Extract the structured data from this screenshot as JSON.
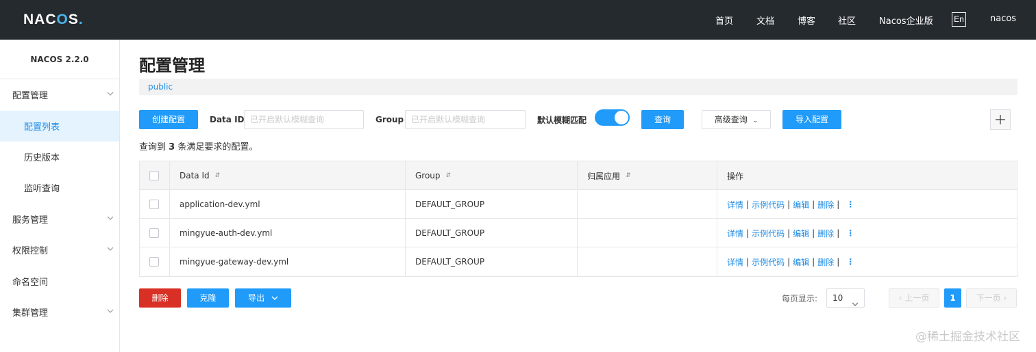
{
  "header": {
    "logo": "NACOS.",
    "nav": [
      "首页",
      "文档",
      "博客",
      "社区",
      "Nacos企业版"
    ],
    "lang": "En",
    "user": "nacos"
  },
  "sidebar": {
    "version": "NACOS 2.2.0",
    "items": [
      {
        "label": "配置管理",
        "type": "parent",
        "expandable": true
      },
      {
        "label": "配置列表",
        "type": "child",
        "active": true
      },
      {
        "label": "历史版本",
        "type": "child"
      },
      {
        "label": "监听查询",
        "type": "child"
      },
      {
        "label": "服务管理",
        "type": "parent",
        "expandable": true
      },
      {
        "label": "权限控制",
        "type": "parent",
        "expandable": true
      },
      {
        "label": "命名空间",
        "type": "parent",
        "expandable": false
      },
      {
        "label": "集群管理",
        "type": "parent",
        "expandable": true
      }
    ]
  },
  "main": {
    "title": "配置管理",
    "namespace": "public",
    "create_button": "创建配置",
    "dataid_label": "Data ID",
    "dataid_placeholder": "已开启默认模糊查询",
    "group_label": "Group",
    "group_placeholder": "已开启默认模糊查询",
    "fuzzy_label": "默认模糊匹配",
    "fuzzy_enabled": true,
    "search_button": "查询",
    "advanced_button": "高级查询",
    "import_button": "导入配置",
    "summary_prefix": "查询到",
    "summary_count": "3",
    "summary_suffix": "条满足要求的配置。"
  },
  "table": {
    "headers": [
      "Data Id",
      "Group",
      "归属应用",
      "操作"
    ],
    "rows": [
      {
        "data_id": "application-dev.yml",
        "group": "DEFAULT_GROUP",
        "app": ""
      },
      {
        "data_id": "mingyue-auth-dev.yml",
        "group": "DEFAULT_GROUP",
        "app": ""
      },
      {
        "data_id": "mingyue-gateway-dev.yml",
        "group": "DEFAULT_GROUP",
        "app": ""
      }
    ],
    "ops": [
      "详情",
      "示例代码",
      "编辑",
      "删除"
    ]
  },
  "footer": {
    "delete_button": "删除",
    "clone_button": "克隆",
    "export_button": "导出",
    "page_size_label": "每页显示:",
    "page_size": "10",
    "prev": "上一页",
    "current_page": "1",
    "next": "下一页"
  },
  "watermark": "@稀土掘金技术社区",
  "colors": {
    "topbar": "#252a2f",
    "primary": "#209bfa",
    "danger": "#d93026",
    "link": "#1e8ce6",
    "active_bg": "#e4f3fe"
  }
}
